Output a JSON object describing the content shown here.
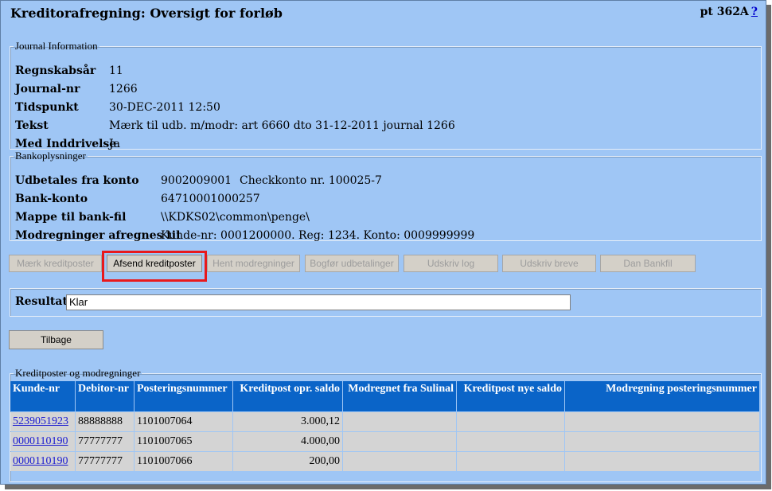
{
  "header": {
    "title": "Kreditorafregning: Oversigt for forløb",
    "code": "pt 362A",
    "help": "?"
  },
  "journal": {
    "legend": "Journal Information",
    "rows": [
      {
        "label": "Regnskabsår",
        "value": "11"
      },
      {
        "label": "Journal-nr",
        "value": "1266"
      },
      {
        "label": "Tidspunkt",
        "value": "30-DEC-2011 12:50"
      },
      {
        "label": "Tekst",
        "value": "Mærk til udb. m/modr: art 6660 dto 31-12-2011 journal 1266"
      },
      {
        "label": "Med Inddrivelse",
        "value": "Ja"
      }
    ]
  },
  "bank": {
    "legend": "Bankoplysninger",
    "rows": [
      {
        "label": "Udbetales fra konto",
        "value": "9002009001",
        "extra": "Checkkonto nr. 100025-7"
      },
      {
        "label": "Bank-konto",
        "value": "64710001000257"
      },
      {
        "label": "Mappe til bank-fil",
        "value": "\\\\KDKS02\\common\\penge\\"
      },
      {
        "label": "Modregninger afregnes til",
        "value": "Kunde-nr: 0001200000. Reg: 1234. Konto: 0009999999"
      }
    ]
  },
  "actions": {
    "mark": "Mærk kreditposter",
    "send": "Afsend kreditposter",
    "fetch": "Hent modregninger",
    "post": "Bogfør udbetalinger",
    "log": "Udskriv log",
    "letters": "Udskriv breve",
    "bankfile": "Dan Bankfil"
  },
  "result": {
    "label": "Resultat",
    "value": "Klar"
  },
  "back_label": "Tilbage",
  "table": {
    "legend": "Kreditposter og modregninger",
    "headers": {
      "kunde": "Kunde-nr",
      "debitor": "Debitor-nr",
      "postering": "Posteringsnummer",
      "opr_saldo": "Kreditpost opr. saldo",
      "modregnet": "Modregnet fra Sulinal",
      "nye_saldo": "Kreditpost nye saldo",
      "modr_post": "Modregning posteringsnummer"
    },
    "rows": [
      {
        "kunde": "5239051923",
        "debitor": "88888888",
        "postering": "1101007064",
        "opr_saldo": "3.000,12",
        "modregnet": "",
        "nye_saldo": "",
        "modr_post": ""
      },
      {
        "kunde": "0000110190",
        "debitor": "77777777",
        "postering": "1101007065",
        "opr_saldo": "4.000,00",
        "modregnet": "",
        "nye_saldo": "",
        "modr_post": ""
      },
      {
        "kunde": "0000110190",
        "debitor": "77777777",
        "postering": "1101007066",
        "opr_saldo": "200,00",
        "modregnet": "",
        "nye_saldo": "",
        "modr_post": ""
      }
    ]
  }
}
